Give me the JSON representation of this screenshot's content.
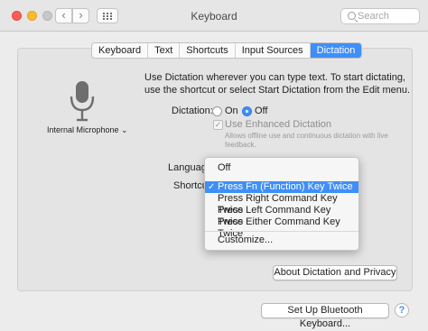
{
  "window": {
    "title": "Keyboard"
  },
  "toolbar": {
    "back": "‹",
    "forward": "›",
    "search_placeholder": "Search"
  },
  "tabs": [
    {
      "label": "Keyboard",
      "active": false
    },
    {
      "label": "Text",
      "active": false
    },
    {
      "label": "Shortcuts",
      "active": false
    },
    {
      "label": "Input Sources",
      "active": false
    },
    {
      "label": "Dictation",
      "active": true
    }
  ],
  "mic": {
    "label": "Internal Microphone ⌄"
  },
  "description": "Use Dictation wherever you can type text. To start dictating, use the shortcut or select Start Dictation from the Edit menu.",
  "dictation": {
    "label": "Dictation:",
    "on_label": "On",
    "off_label": "Off",
    "selected": "Off"
  },
  "enhanced": {
    "label": "Use Enhanced Dictation",
    "sublabel": "Allows offline use and continuous dictation with live feedback.",
    "checked": true
  },
  "language": {
    "label": "Language"
  },
  "shortcut": {
    "label": "Shortcut",
    "menu": {
      "items": [
        "Off",
        "Press Fn (Function) Key Twice",
        "Press Right Command Key Twice",
        "Press Left Command Key Twice",
        "Press Either Command Key Twice",
        "Customize..."
      ],
      "selected": "Press Fn (Function) Key Twice"
    }
  },
  "buttons": {
    "about": "About Dictation and Privacy",
    "bluetooth": "Set Up Bluetooth Keyboard...",
    "help": "?"
  },
  "colors": {
    "accent": "#3f8ff8"
  }
}
